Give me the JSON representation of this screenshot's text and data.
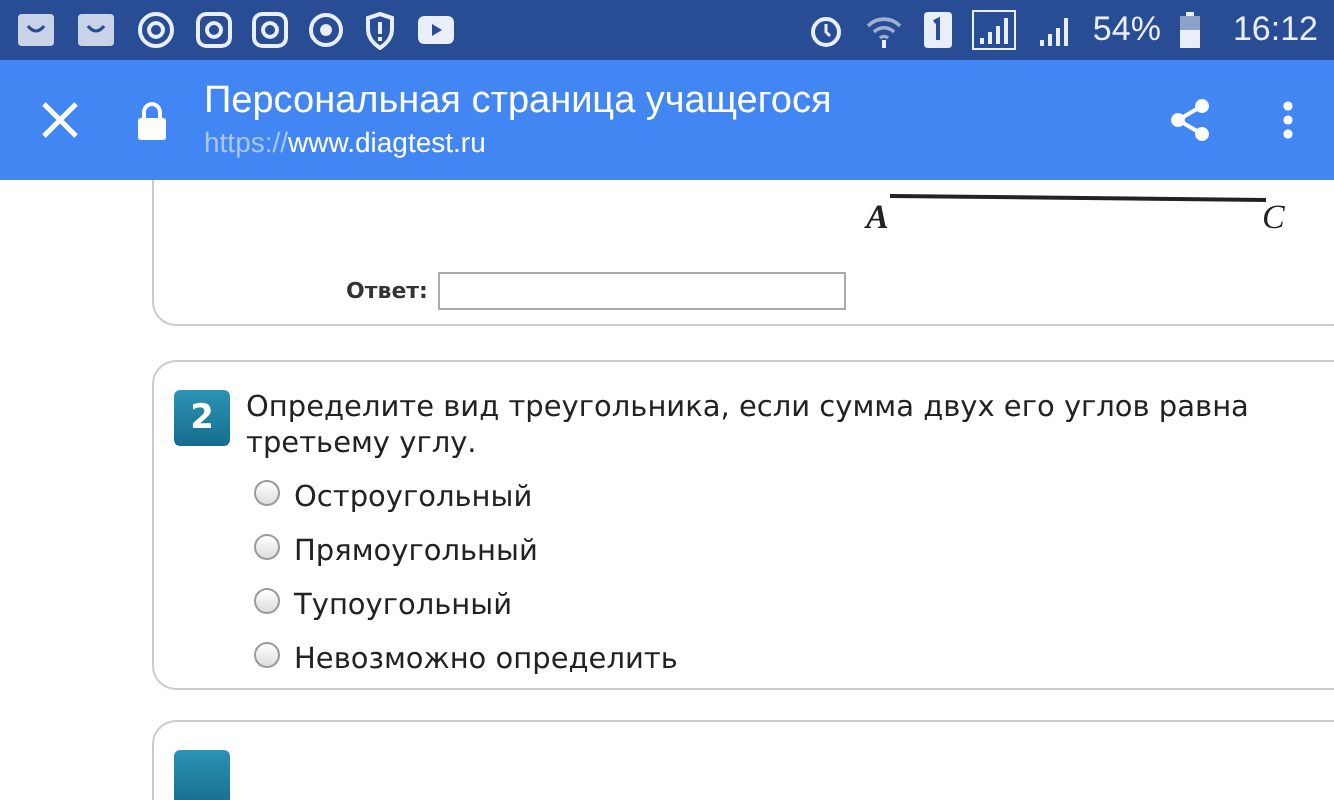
{
  "status_bar": {
    "battery": "54%",
    "time": "16:12"
  },
  "header": {
    "title": "Персональная страница учащегося",
    "url_scheme": "https://",
    "url_host": "www.diagtest.ru"
  },
  "question_1": {
    "figure_labels": [
      "A",
      "C"
    ],
    "answer_label": "Ответ:"
  },
  "question_2": {
    "number": "2",
    "text": "Определите вид треугольника, если сумма двух его углов равна третьему углу.",
    "options": [
      {
        "label": "Остроугольный",
        "selected": false
      },
      {
        "label": "Прямоугольный",
        "selected": false
      },
      {
        "label": "Тупоугольный",
        "selected": false
      },
      {
        "label": "Невозможно определить",
        "selected": false
      }
    ]
  }
}
